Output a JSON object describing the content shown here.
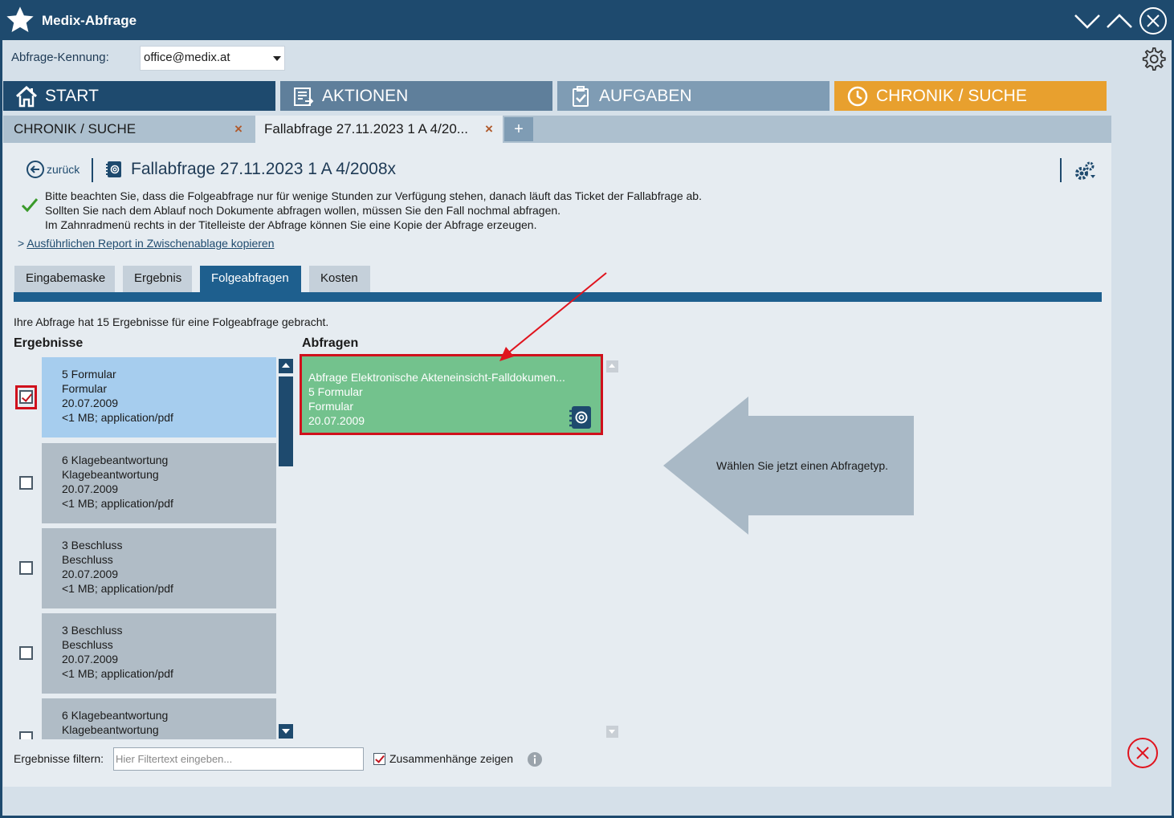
{
  "window": {
    "title": "Medix-Abfrage"
  },
  "kennung": {
    "label": "Abfrage-Kennung:",
    "value": "office@medix.at"
  },
  "main_tabs": [
    {
      "label": "START",
      "icon": "home-icon",
      "color": "#1e4a6e"
    },
    {
      "label": "AKTIONEN",
      "icon": "actions-list-icon",
      "color": "#5f7f9b"
    },
    {
      "label": "AUFGABEN",
      "icon": "clipboard-check-icon",
      "color": "#7f9cb4"
    },
    {
      "label": "CHRONIK / SUCHE",
      "icon": "clock-icon",
      "color": "#e8a02e",
      "active": true
    }
  ],
  "sub_tabs": [
    {
      "label": "CHRONIK / SUCHE",
      "close": "×"
    },
    {
      "label": "Fallabfrage 27.11.2023 1 A 4/20...",
      "close": "×",
      "active": true
    }
  ],
  "sub_tab_add": "+",
  "header": {
    "back_label": "zurück",
    "title": "Fallabfrage 27.11.2023 1 A 4/2008x"
  },
  "info": {
    "lines": [
      "Bitte beachten Sie, dass die Folgeabfrage nur für wenige Stunden zur Verfügung stehen, danach läuft das Ticket der Fallabfrage ab.",
      "Sollten Sie nach dem Ablauf noch Dokumente abfragen wollen, müssen Sie den Fall nochmal abfragen.",
      "Im Zahnradmenü rechts in der Titelleiste der Abfrage können Sie eine Kopie der Abfrage erzeugen."
    ],
    "report_prefix": ">",
    "report_link": "Ausführlichen Report in Zwischenablage kopieren"
  },
  "content_tabs": [
    {
      "label": "Eingabemaske"
    },
    {
      "label": "Ergebnis"
    },
    {
      "label": "Folgeabfragen",
      "active": true
    },
    {
      "label": "Kosten"
    }
  ],
  "summary": "Ihre Abfrage hat 15 Ergebnisse für eine Folgeabfrage gebracht.",
  "ergebnisse": {
    "heading": "Ergebnisse",
    "items": [
      {
        "line1": "5 Formular",
        "line2": "Formular",
        "line3": "20.07.2009",
        "line4": "<1 MB; application/pdf",
        "checked": true,
        "selected": true
      },
      {
        "line1": "6 Klagebeantwortung",
        "line2": "Klagebeantwortung",
        "line3": "20.07.2009",
        "line4": "<1 MB; application/pdf",
        "checked": false
      },
      {
        "line1": "3 Beschluss",
        "line2": "Beschluss",
        "line3": "20.07.2009",
        "line4": "<1 MB; application/pdf",
        "checked": false
      },
      {
        "line1": "3 Beschluss",
        "line2": "Beschluss",
        "line3": "20.07.2009",
        "line4": "<1 MB; application/pdf",
        "checked": false
      },
      {
        "line1": "6 Klagebeantwortung",
        "line2": "Klagebeantwortung",
        "line3": "",
        "line4": "",
        "checked": false
      }
    ]
  },
  "abfragen": {
    "heading": "Abfragen",
    "card": {
      "title": "Abfrage Elektronische Akteneinsicht-Falldokumen...",
      "line2": "5 Formular",
      "line3": "Formular",
      "line4": "20.07.2009",
      "color": "#73c28d"
    },
    "hint": "Wählen Sie jetzt einen Abfragetyp."
  },
  "filter": {
    "label": "Ergebnisse filtern:",
    "placeholder": "Hier Filtertext eingeben...",
    "zusammenhaenge_label": "Zusammenhänge zeigen",
    "zusammenhaenge_checked": true
  }
}
